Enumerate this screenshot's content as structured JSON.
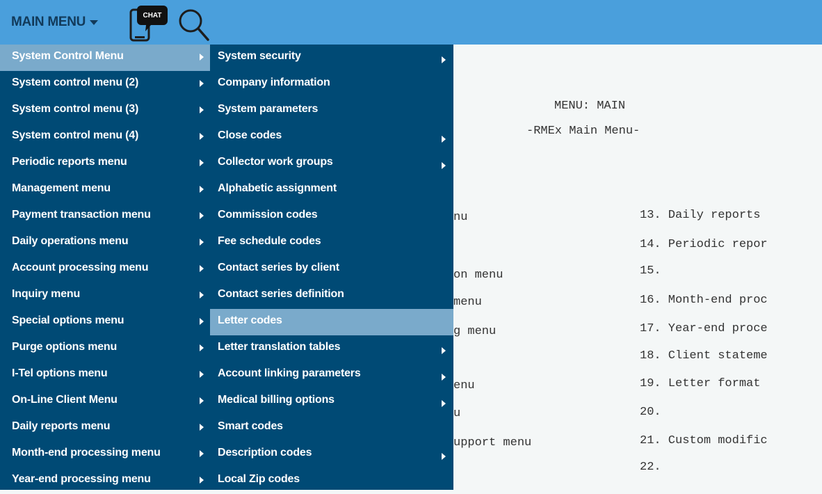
{
  "topbar": {
    "main_menu_label": "MAIN MENU",
    "chat_badge": "CHAT",
    "colors": {
      "bar": "#4a9fdc",
      "menu_bg": "#004a75",
      "highlight": "#7aaacb"
    }
  },
  "terminal": {
    "menu_name": "MENU: MAIN",
    "menu_subtitle": "-RMEx Main Menu-",
    "left_fragments": [
      "nu",
      "on menu",
      "menu",
      "g menu",
      "enu",
      "u",
      "upport menu"
    ],
    "right_lines": [
      "13. Daily reports",
      "14. Periodic repor",
      "15.",
      "16. Month-end proc",
      "17. Year-end proce",
      "18. Client stateme",
      "19. Letter format",
      "20.",
      "21. Custom modific",
      "22."
    ]
  },
  "menu1": {
    "items": [
      "System Control Menu",
      "System control menu (2)",
      "System control menu (3)",
      "System control menu (4)",
      "Periodic reports menu",
      "Management menu",
      "Payment transaction menu",
      "Daily operations menu",
      "Account processing menu",
      "Inquiry menu",
      "Special options menu",
      "Purge options menu",
      "I-Tel options menu",
      "On-Line Client Menu",
      "Daily reports menu",
      "Month-end processing menu",
      "Year-end processing menu"
    ],
    "highlighted": "System Control Menu"
  },
  "menu2": {
    "items": [
      "System security",
      "Company information",
      "System parameters",
      "Close codes",
      "Collector work groups",
      "Alphabetic assignment",
      "Commission codes",
      "Fee schedule codes",
      "Contact series by client",
      "Contact series definition",
      "Letter codes",
      "Letter translation tables",
      "Account linking parameters",
      "Medical billing options",
      "Smart codes",
      "Description codes",
      "Local Zip codes"
    ],
    "highlighted": "Letter codes"
  }
}
